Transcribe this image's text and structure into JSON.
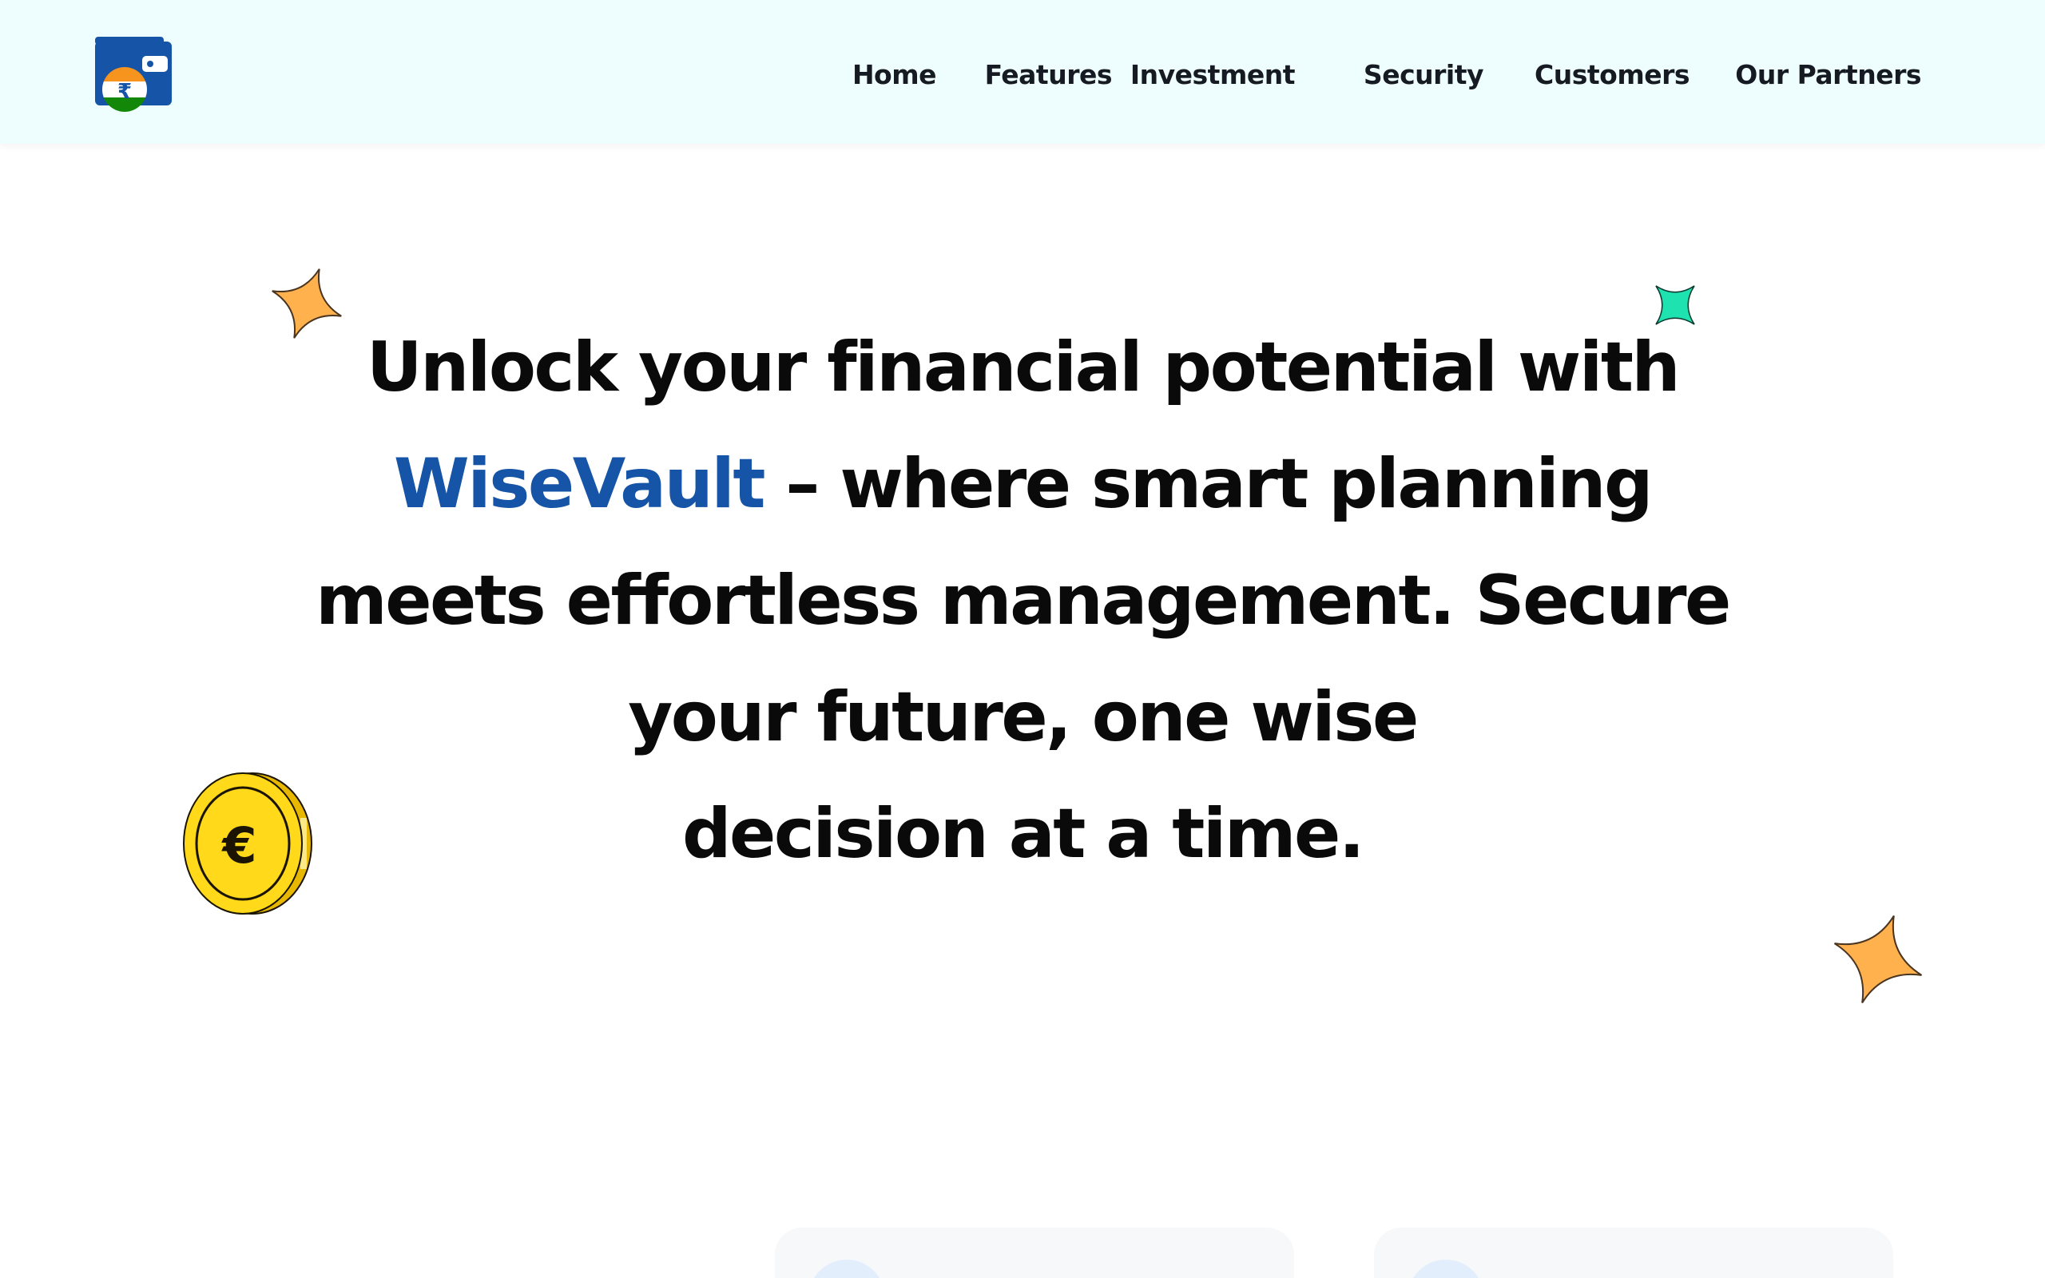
{
  "brand": {
    "name": "WiseVault",
    "logo_icon": "wallet-rupee-icon",
    "accent_color": "#1554a6"
  },
  "nav": {
    "items": [
      {
        "label": "Home"
      },
      {
        "label": "Features"
      },
      {
        "label": "Investment"
      },
      {
        "label": "Security"
      },
      {
        "label": "Customers"
      },
      {
        "label": "Our Partners"
      }
    ]
  },
  "hero": {
    "line1": "Unlock your financial potential with",
    "line2_brand": "WiseVault",
    "line2_rest": " – where smart planning",
    "line3": "meets effortless management. Secure",
    "line4": "your future, one wise",
    "line5": "decision at a time."
  },
  "decorations": {
    "star_top_left": "orange-sparkle-icon",
    "star_top_right": "green-sparkle-icon",
    "coin": "gold-coin-icon",
    "star_bottom_right": "orange-sparkle-icon"
  },
  "colors": {
    "header_bg": "#eefdfd",
    "star_orange": "#ffb14e",
    "star_green": "#1ee3b0",
    "coin_gold": "#ffd91a"
  }
}
